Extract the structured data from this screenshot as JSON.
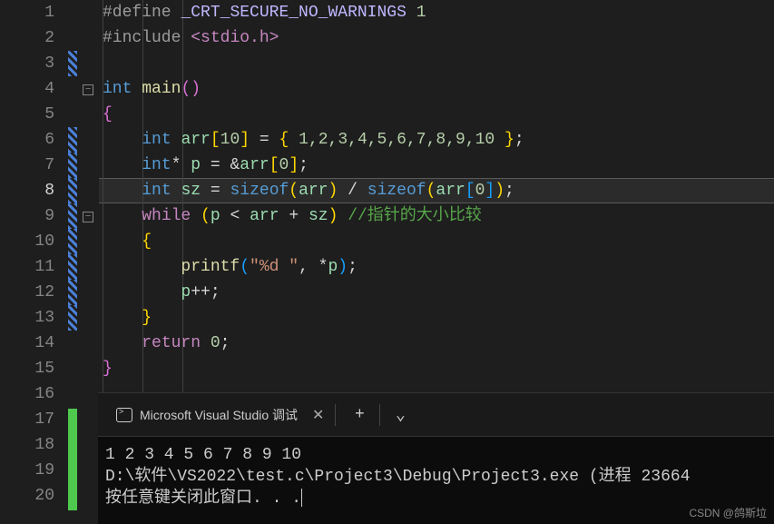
{
  "lineNumbers": [
    "1",
    "2",
    "3",
    "4",
    "5",
    "6",
    "7",
    "8",
    "9",
    "10",
    "11",
    "12",
    "13",
    "14",
    "15",
    "16",
    "17",
    "18",
    "19",
    "20"
  ],
  "currentLine": 8,
  "code": {
    "l1": {
      "define": "#define",
      "mac": "_CRT_SECURE_NO_WARNINGS",
      "one": "1"
    },
    "l2": {
      "include": "#include",
      "hdr": "<stdio.h>"
    },
    "l4": {
      "int": "int",
      "main": "main"
    },
    "l5": {
      "brace": "{"
    },
    "l6": {
      "int": "int",
      "arr": "arr",
      "idx": "10",
      "vals": "1,2,3,4,5,6,7,8,9,10"
    },
    "l7": {
      "int": "int",
      "p": "p",
      "arr": "arr",
      "zero": "0"
    },
    "l8": {
      "int": "int",
      "sz": "sz",
      "sizeof1": "sizeof",
      "arr": "arr",
      "sizeof2": "sizeof",
      "arr2": "arr",
      "zero": "0"
    },
    "l9": {
      "while": "while",
      "p": "p",
      "arr": "arr",
      "sz": "sz",
      "comment": "//指针的大小比较"
    },
    "l10": {
      "brace": "{"
    },
    "l11": {
      "printf": "printf",
      "fmt": "\"%d \"",
      "p": "p"
    },
    "l12": {
      "p": "p",
      "pp": "++"
    },
    "l13": {
      "brace": "}"
    },
    "l14": {
      "return": "return",
      "zero": "0"
    },
    "l15": {
      "brace": "}"
    }
  },
  "terminal": {
    "tabTitle": "Microsoft Visual Studio 调试",
    "output1": "1 2 3 4 5 6 7 8 9 10",
    "output2": "D:\\软件\\VS2022\\test.c\\Project3\\Debug\\Project3.exe (进程 23664",
    "output3": "按任意键关闭此窗口. . ."
  },
  "watermark": "CSDN @鸽斯垃"
}
